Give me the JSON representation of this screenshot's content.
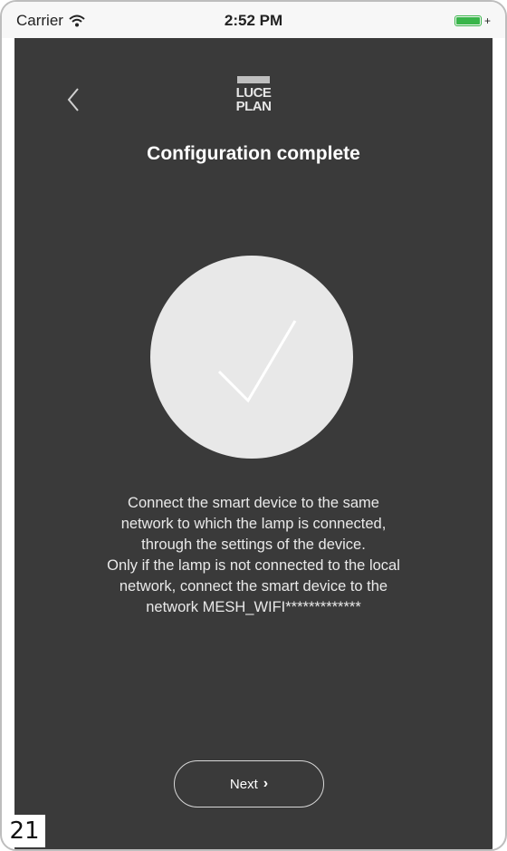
{
  "status_bar": {
    "carrier": "Carrier",
    "time": "2:52 PM"
  },
  "header": {
    "back_icon": "chevron-left-icon",
    "logo_line1": "LUCE",
    "logo_line2": "PLAN",
    "title": "Configuration complete"
  },
  "main": {
    "success_icon": "checkmark-icon",
    "message_lines": [
      "Connect the smart device to the same",
      "network to which the lamp is connected,",
      "through the settings of the device.",
      "Only if the lamp is not connected to the local",
      "network, connect the smart device to the",
      "network MESH_WIFI*************"
    ]
  },
  "footer": {
    "next_label": "Next",
    "next_icon": "chevron-right-icon"
  },
  "page_label": "21",
  "colors": {
    "screen_background": "#3a3a3a",
    "circle": "#e8e8e8",
    "battery": "#39b54a"
  }
}
